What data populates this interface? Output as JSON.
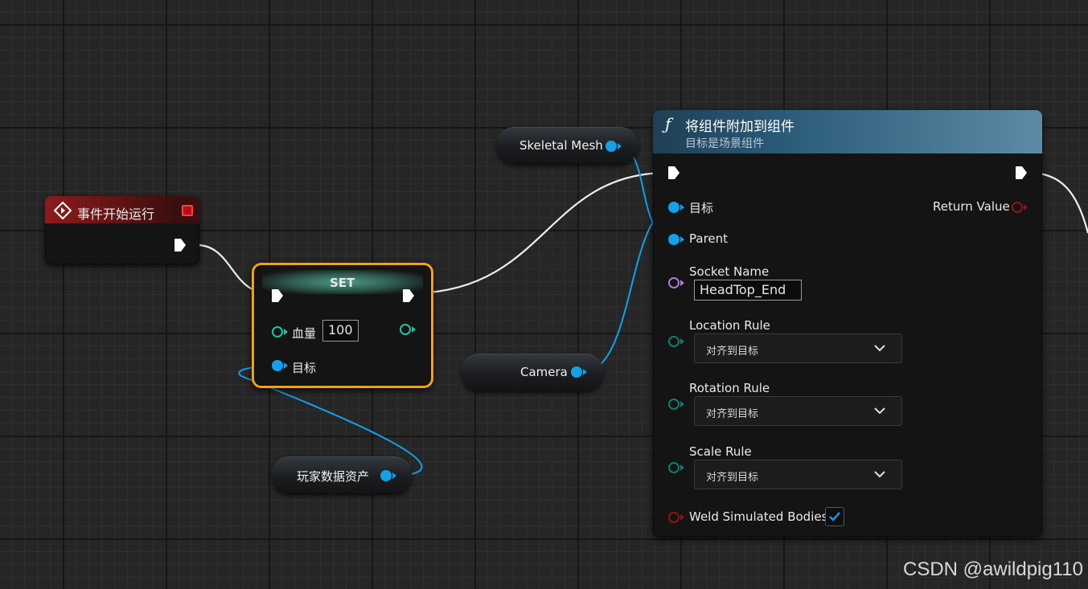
{
  "event_node": {
    "title": "事件开始运行"
  },
  "set_node": {
    "title": "SET",
    "health_label": "血量",
    "health_value": "100",
    "target_label": "目标"
  },
  "vars": {
    "skeletal_mesh": "Skeletal Mesh",
    "camera": "Camera",
    "player_data": "玩家数据资产"
  },
  "attach_node": {
    "func_icon": "ƒ",
    "title": "将组件附加到组件",
    "subtitle": "目标是场景组件",
    "target_label": "目标",
    "parent_label": "Parent",
    "return_label": "Return Value",
    "socket_label": "Socket Name",
    "socket_value": "HeadTop_End",
    "location_rule_label": "Location Rule",
    "location_rule_value": "对齐到目标",
    "rotation_rule_label": "Rotation Rule",
    "rotation_rule_value": "对齐到目标",
    "scale_rule_label": "Scale Rule",
    "scale_rule_value": "对齐到目标",
    "weld_label": "Weld Simulated Bodies",
    "weld_checked": true
  },
  "colors": {
    "object_pin": "#12a0ec",
    "int_pin": "#1fc5a3",
    "name_pin": "#b07ad9",
    "enum_pin": "#137a72",
    "bool_pin": "#8c1414",
    "event_header": "#8e1a1a",
    "function_header": "#2b5c7a",
    "set_header": "#3b6b5e",
    "selection_outline": "#f2a20c"
  },
  "watermark": "CSDN @awildpig110"
}
